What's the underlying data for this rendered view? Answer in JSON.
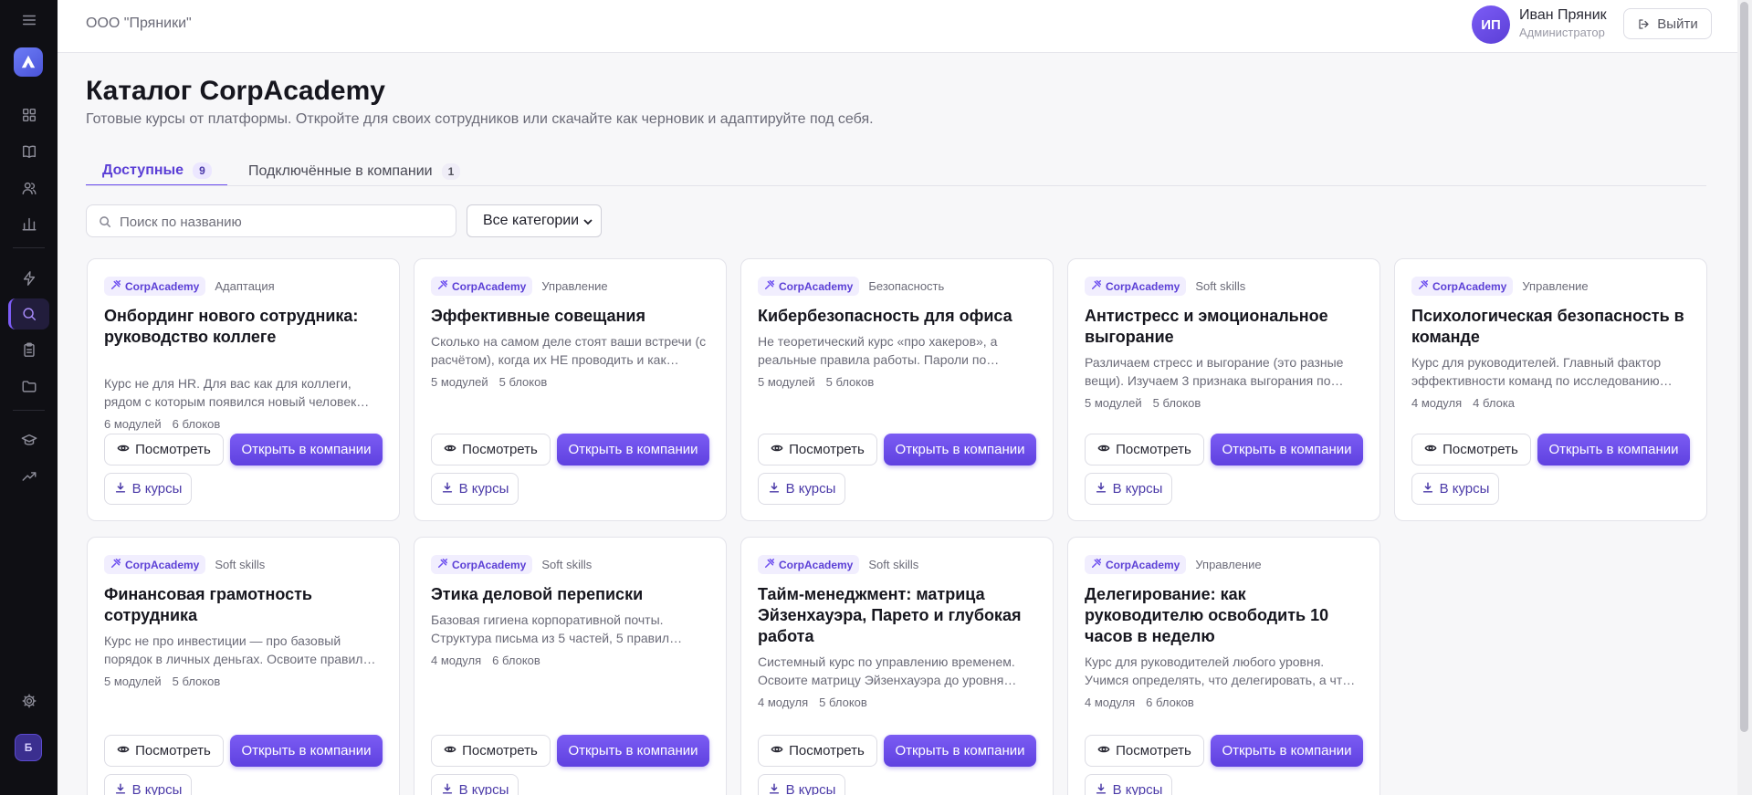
{
  "company": "ООО \"Пряники\"",
  "user": {
    "initials": "ИП",
    "name": "Иван Пряник",
    "role": "Администратор",
    "logout_label": "Выйти"
  },
  "sidebar": {
    "avatar_letter": "Б",
    "icons": [
      "menu-icon",
      "dashboard-icon",
      "book-icon",
      "users-icon",
      "chart-icon",
      "bolt-icon",
      "search-icon",
      "clipboard-icon",
      "folder-icon",
      "graduation-cap-icon",
      "trending-up-icon",
      "gear-icon"
    ]
  },
  "page": {
    "title": "Каталог CorpAcademy",
    "subtitle": "Готовые курсы от платформы. Откройте для своих сотрудников или скачайте как черновик и адаптируйте под себя."
  },
  "tabs": [
    {
      "label": "Доступные",
      "count": "9"
    },
    {
      "label": "Подключённые в компании",
      "count": "1"
    }
  ],
  "filters": {
    "search_placeholder": "Поиск по названию",
    "category_selected": "Все категории"
  },
  "card_buttons": {
    "brand": "CorpAcademy",
    "view": "Посмотреть",
    "open": "Открыть в компании",
    "add": "В курсы"
  },
  "courses": [
    {
      "category": "Адаптация",
      "title": "Онбординг нового сотрудника: руководство коллеге",
      "description": "Курс не для HR. Для вас как для коллеги, рядом с которым появился новый человек…",
      "modules": "6 модулей",
      "blocks": "6 блоков"
    },
    {
      "category": "Управление",
      "title": "Эффективные совещания",
      "description": "Сколько на самом деле стоят ваши встречи (с расчётом), когда их НЕ проводить и как…",
      "modules": "5 модулей",
      "blocks": "5 блоков"
    },
    {
      "category": "Безопасность",
      "title": "Кибербезопасность для офиса",
      "description": "Не теоретический курс «про хакеров», а реальные правила работы. Пароли по…",
      "modules": "5 модулей",
      "blocks": "5 блоков"
    },
    {
      "category": "Soft skills",
      "title": "Антистресс и эмоциональное выгорание",
      "description": "Различаем стресс и выгорание (это разные вещи). Изучаем 3 признака выгорания по…",
      "modules": "5 модулей",
      "blocks": "5 блоков"
    },
    {
      "category": "Управление",
      "title": "Психологическая безопасность в команде",
      "description": "Курс для руководителей. Главный фактор эффективности команд по исследованию…",
      "modules": "4 модуля",
      "blocks": "4 блока"
    },
    {
      "category": "Soft skills",
      "title": "Финансовая грамотность сотрудника",
      "description": "Курс не про инвестиции — про базовый порядок в личных деньгах. Освоите правил…",
      "modules": "5 модулей",
      "blocks": "5 блоков"
    },
    {
      "category": "Soft skills",
      "title": "Этика деловой переписки",
      "description": "Базовая гигиена корпоративной почты. Структура письма из 5 частей, 5 правил…",
      "modules": "4 модуля",
      "blocks": "6 блоков"
    },
    {
      "category": "Soft skills",
      "title": "Тайм-менеджмент: матрица Эйзенхауэра, Парето и глубокая работа",
      "description": "Системный курс по управлению временем. Освоите матрицу Эйзенхауэра до уровня…",
      "modules": "4 модуля",
      "blocks": "5 блоков"
    },
    {
      "category": "Управление",
      "title": "Делегирование: как руководителю освободить 10 часов в неделю",
      "description": "Курс для руководителей любого уровня. Учимся определять, что делегировать, а чт…",
      "modules": "4 модуля",
      "blocks": "6 блоков"
    }
  ]
}
